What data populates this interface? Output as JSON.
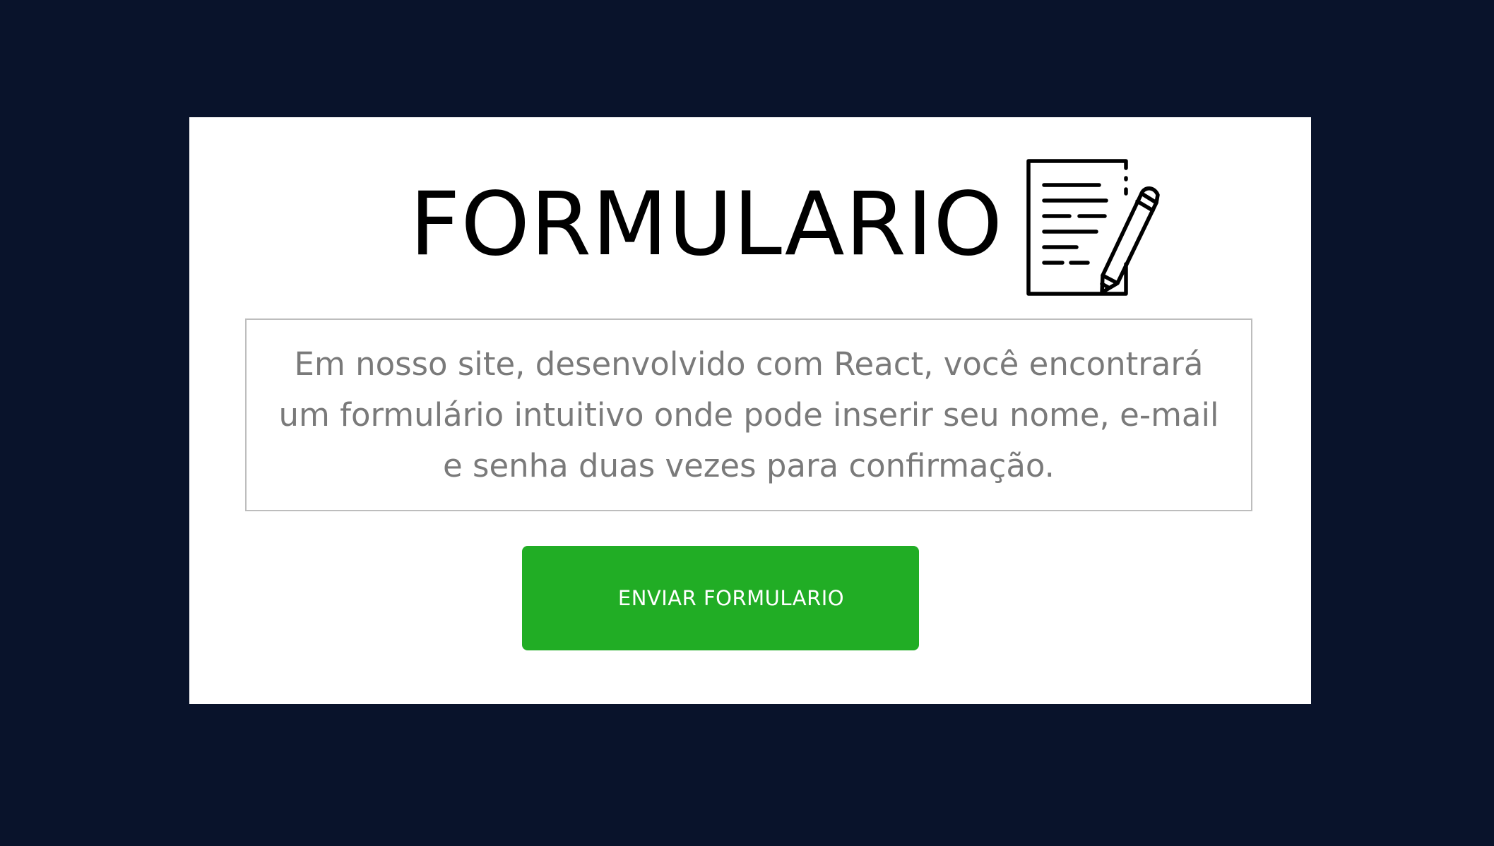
{
  "page": {
    "background_color": "#09132b",
    "card_color": "#ffffff"
  },
  "header": {
    "title": "FORMULARIO",
    "icon": "document-with-pencil-icon"
  },
  "description": {
    "text": "Em nosso site, desenvolvido com React, você encontrará um formulário intuitivo onde pode inserir seu nome, e-mail e senha duas vezes para confirmação."
  },
  "actions": {
    "submit_label": "ENVIAR FORMULARIO",
    "submit_color": "#21ad25"
  }
}
